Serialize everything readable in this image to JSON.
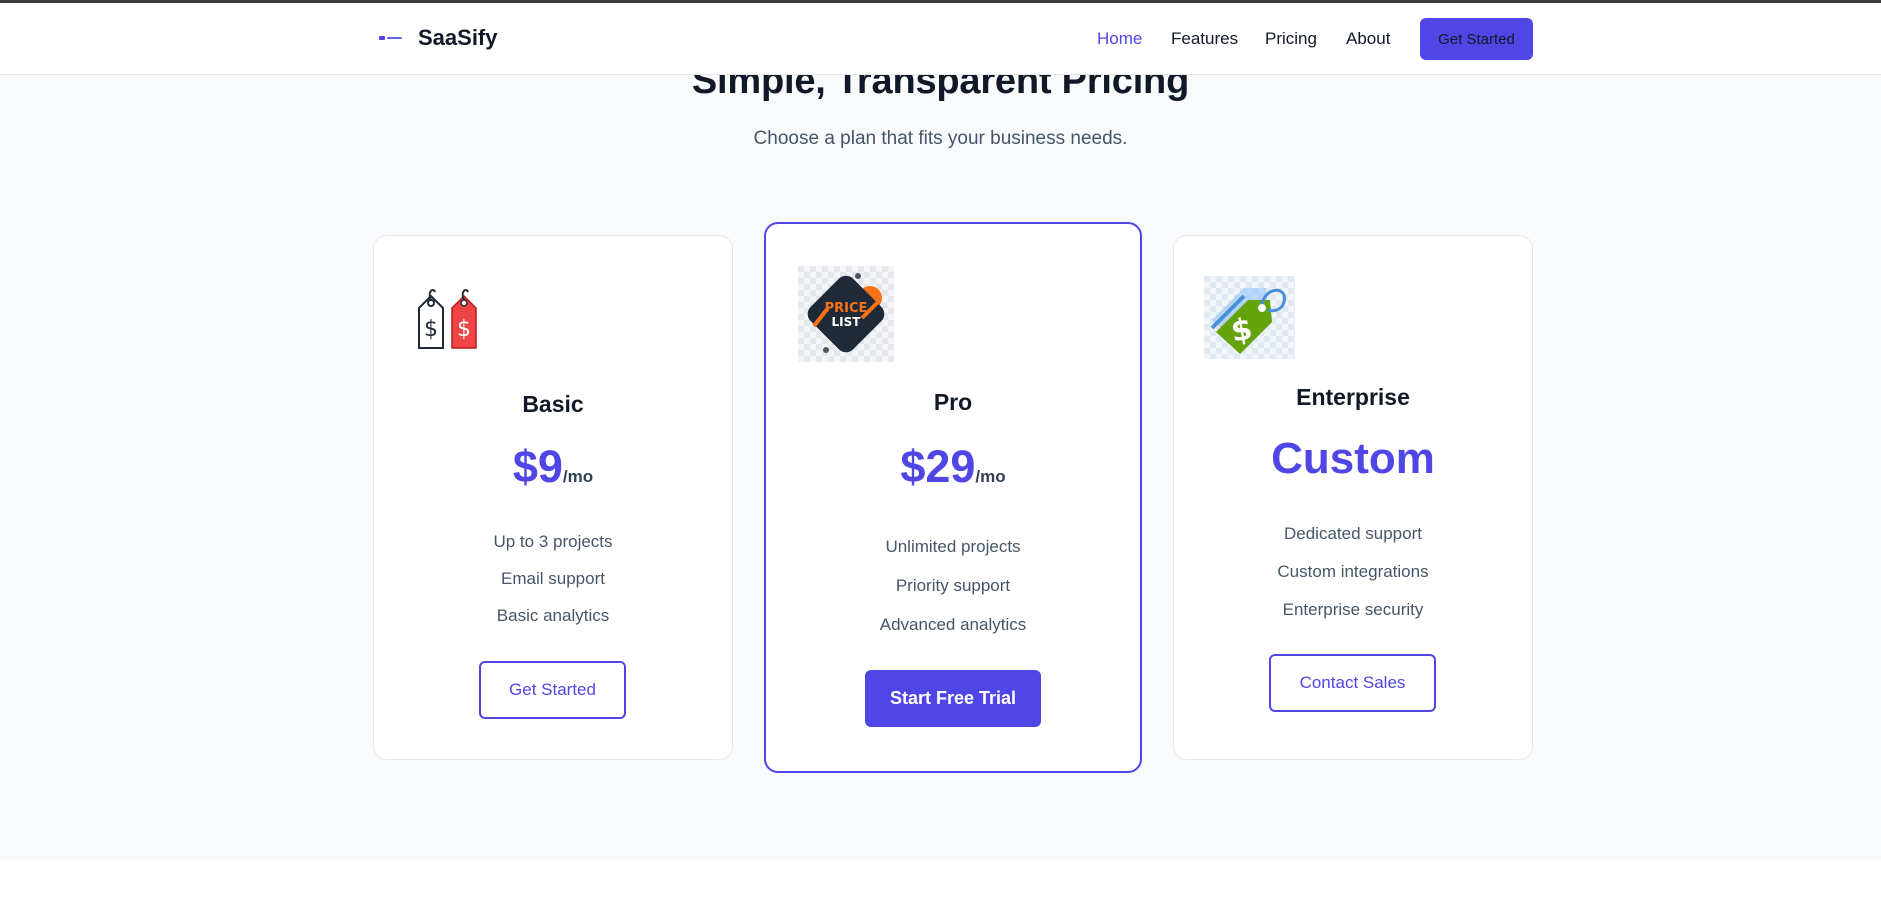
{
  "nav": {
    "brand": "SaaSify",
    "links": [
      {
        "label": "Home",
        "active": true
      },
      {
        "label": "Features",
        "active": false
      },
      {
        "label": "Pricing",
        "active": false
      },
      {
        "label": "About",
        "active": false
      }
    ],
    "cta": "Get Started"
  },
  "hero": {
    "title": "Simple, Transparent Pricing",
    "subtitle": "Choose a plan that fits your business needs."
  },
  "plans": [
    {
      "name": "Basic",
      "price": "$9",
      "period": "/mo",
      "icon": "price-tags-icon",
      "features": [
        "Up to 3 projects",
        "Email support",
        "Basic analytics"
      ],
      "button": "Get Started"
    },
    {
      "name": "Pro",
      "price": "$29",
      "period": "/mo",
      "icon": "price-list-badge-icon",
      "badge_text_line1": "PRICE",
      "badge_text_line2": "LIST",
      "features": [
        "Unlimited projects",
        "Priority support",
        "Advanced analytics"
      ],
      "button": "Start Free Trial",
      "featured": true
    },
    {
      "name": "Enterprise",
      "price": "Custom",
      "icon": "dollar-tag-icon",
      "features": [
        "Dedicated support",
        "Custom integrations",
        "Enterprise security"
      ],
      "button": "Contact Sales"
    }
  ],
  "colors": {
    "accent": "#4f46e5",
    "heading": "#111827",
    "body_text": "#475569",
    "page_background": "#f8fafc"
  }
}
